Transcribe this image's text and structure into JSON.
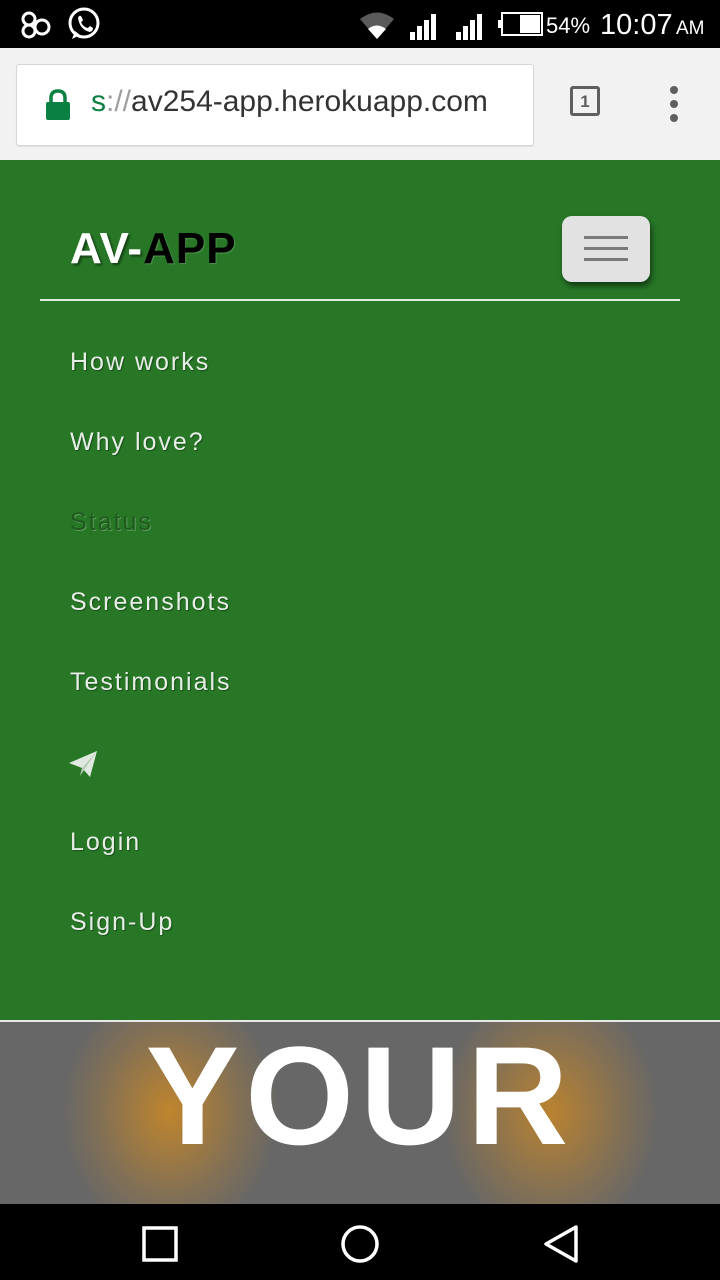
{
  "status_bar": {
    "battery_percent": "54%",
    "time": "10:07",
    "ampm": "AM",
    "icons": [
      "link-icon",
      "whatsapp-icon",
      "wifi-icon",
      "signal-icon",
      "signal-icon",
      "battery-icon"
    ]
  },
  "browser": {
    "url_scheme": "s",
    "url_separator": "://",
    "url_host": "av254-app.herokuapp.com",
    "tab_count": "1",
    "icons": [
      "lock-icon",
      "tabs-icon",
      "more-vert-icon"
    ]
  },
  "site_nav": {
    "brand_white": "AV-",
    "brand_black": "APP",
    "background_color": "#277726",
    "items": [
      {
        "label": "How works"
      },
      {
        "label": "Why love?"
      },
      {
        "label": "Status"
      },
      {
        "label": "Screenshots"
      },
      {
        "label": "Testimonials"
      },
      {
        "label": "Login"
      },
      {
        "label": "Sign-Up"
      }
    ],
    "icons": [
      "hamburger-icon",
      "paper-plane-icon"
    ]
  },
  "hero": {
    "heading": "YOUR"
  },
  "system_nav": {
    "icons": [
      "recent-apps-icon",
      "home-icon",
      "back-icon"
    ]
  }
}
